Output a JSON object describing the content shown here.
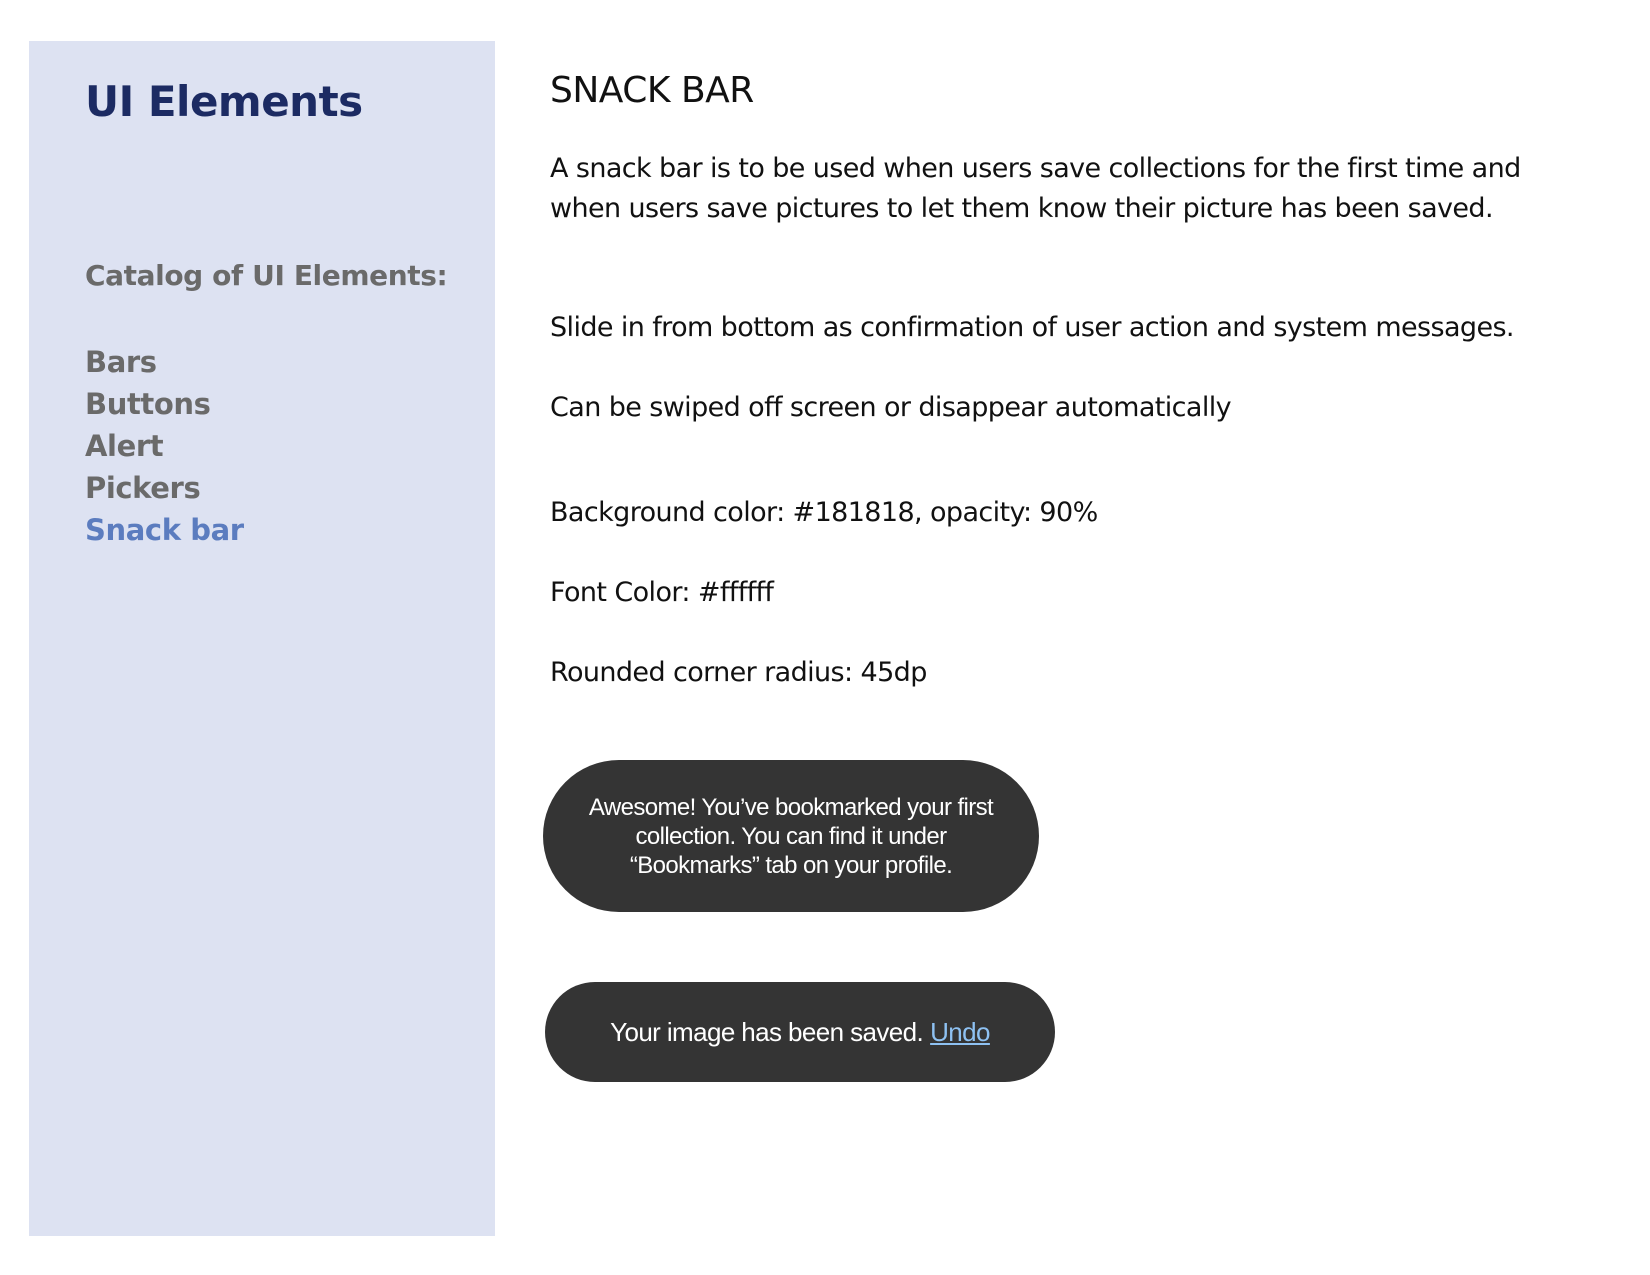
{
  "sidebar": {
    "title": "UI Elements",
    "catalog_heading": "Catalog of UI Elements:",
    "items": [
      {
        "label": "Bars"
      },
      {
        "label": "Buttons"
      },
      {
        "label": "Alert"
      },
      {
        "label": "Pickers"
      },
      {
        "label": "Snack bar",
        "active": true
      }
    ]
  },
  "main": {
    "title": "SNACK BAR",
    "paragraphs": [
      "A snack bar is to be used when users save collections for the first time and when users save pictures to let them know their picture has been saved.",
      "Slide in from bottom as confirmation of user action and system messages.",
      "Can be swiped off screen or disappear automatically",
      "Background color: #181818, opacity: 90%",
      "Font Color: #ffffff",
      "Rounded corner radius: 45dp"
    ],
    "snackbars": {
      "bookmark_message": "Awesome! You’ve bookmarked your first collection. You can find it under “Bookmarks” tab on your profile.",
      "saved_message": "Your  image has been saved.",
      "undo_label": "Undo"
    }
  },
  "colors": {
    "sidebar_bg": "#dde2f2",
    "title_color": "#1c2b63",
    "nav_text": "#6a6a6a",
    "nav_active": "#5b7cbf",
    "snackbar_bg": "#343434",
    "undo_link": "#8ec1f2"
  }
}
